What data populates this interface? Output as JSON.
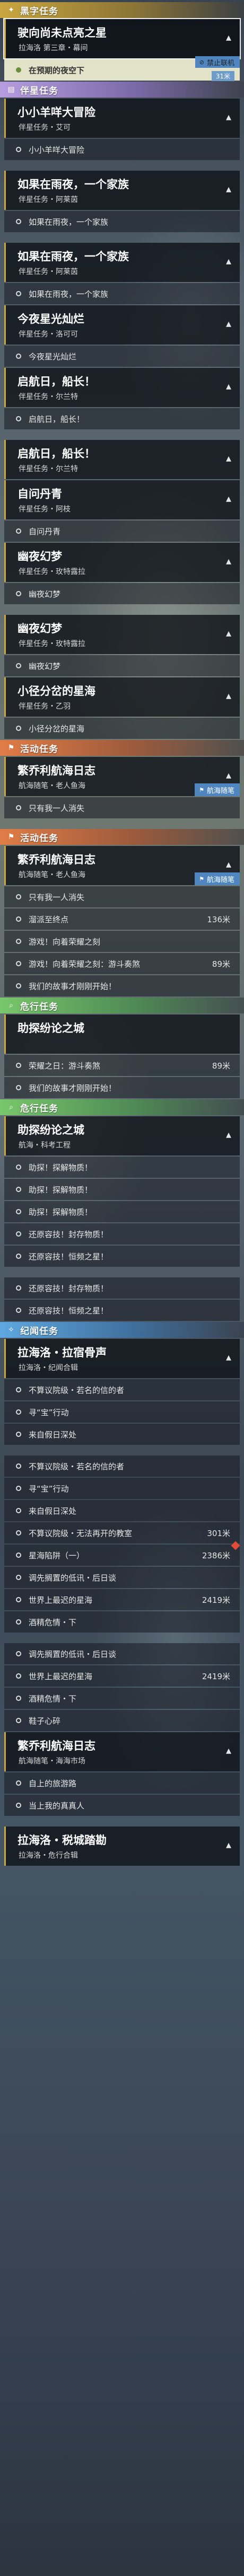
{
  "rows": [
    {
      "k": "header",
      "style": "gold",
      "icon": "star-icon",
      "title": "黑字任务"
    },
    {
      "k": "card",
      "title": "驶向尚未点亮之星",
      "sub": "拉海洛 第三章・幕间",
      "chev": "▴"
    },
    {
      "k": "obj",
      "text": "在预期的夜空下",
      "hl": true,
      "dist": "31米",
      "badge": "禁止联机"
    },
    {
      "k": "header",
      "style": "purple",
      "icon": "book-icon",
      "title": "伴星任务"
    },
    {
      "k": "card",
      "title": "小小羊咩大冒险",
      "sub": "伴星任务・艾可",
      "chev": "▴"
    },
    {
      "k": "obj",
      "text": "小小羊咩大冒险"
    },
    {
      "k": "gap"
    },
    {
      "k": "card",
      "title": "如果在雨夜，一个家族",
      "sub": "伴星任务・阿莱茵",
      "chev": "▴"
    },
    {
      "k": "obj",
      "text": "如果在雨夜，一个家族"
    },
    {
      "k": "gap"
    },
    {
      "k": "card",
      "title": "如果在雨夜，一个家族",
      "sub": "伴星任务・阿莱茵",
      "chev": "▴"
    },
    {
      "k": "obj",
      "text": "如果在雨夜，一个家族"
    },
    {
      "k": "card",
      "title": "今夜星光灿烂",
      "sub": "伴星任务・洛可可",
      "chev": "▴"
    },
    {
      "k": "obj",
      "text": "今夜星光灿烂"
    },
    {
      "k": "card",
      "title": "启航日，船长！",
      "sub": "伴星任务・尔兰特",
      "chev": "▴"
    },
    {
      "k": "obj",
      "text": "启航日，船长！"
    },
    {
      "k": "gap"
    },
    {
      "k": "card",
      "title": "启航日，船长！",
      "sub": "伴星任务・尔兰特",
      "chev": "▴"
    },
    {
      "k": "card",
      "title": "自问丹青",
      "sub": "伴星任务・阿枝",
      "chev": "▴"
    },
    {
      "k": "obj",
      "text": "自问丹青"
    },
    {
      "k": "card",
      "title": "幽夜幻梦",
      "sub": "伴星任务・玫特露拉",
      "chev": "▴"
    },
    {
      "k": "obj",
      "text": "幽夜幻梦"
    },
    {
      "k": "gap"
    },
    {
      "k": "card",
      "title": "幽夜幻梦",
      "sub": "伴星任务・玫特露拉",
      "chev": "▴"
    },
    {
      "k": "obj",
      "text": "幽夜幻梦"
    },
    {
      "k": "card",
      "title": "小径分岔的星海",
      "sub": "伴星任务・乙羽",
      "chev": "▴"
    },
    {
      "k": "obj",
      "text": "小径分岔的星海"
    },
    {
      "k": "header",
      "style": "orange",
      "icon": "flag-icon",
      "title": "活动任务"
    },
    {
      "k": "card",
      "title": "繁乔利航海日志",
      "sub": "航海随笔・老人鱼海",
      "chev": "▴",
      "badge": "航海随笔"
    },
    {
      "k": "obj",
      "text": "只有我一人消失"
    },
    {
      "k": "gap"
    },
    {
      "k": "header",
      "style": "orange",
      "icon": "flag-icon",
      "title": "活动任务"
    },
    {
      "k": "card",
      "title": "繁乔利航海日志",
      "sub": "航海随笔・老人鱼海",
      "chev": "▴",
      "badge": "航海随笔"
    },
    {
      "k": "obj",
      "text": "只有我一人消失"
    },
    {
      "k": "obj",
      "text": "溜派至终点",
      "dist": "136米"
    },
    {
      "k": "obj",
      "text": "游戏！向着荣耀之刻"
    },
    {
      "k": "obj",
      "text": "游戏！向着荣耀之刻：游斗奏煞",
      "dist": "89米"
    },
    {
      "k": "obj",
      "text": "我们的故事才刚刚开始！"
    },
    {
      "k": "header",
      "style": "green",
      "icon": "search-icon",
      "title": "危行任务"
    },
    {
      "k": "card",
      "title": "助探纷论之城",
      "sub": "",
      "chev": ""
    },
    {
      "k": "obj",
      "text": "荣耀之日：游斗奏煞",
      "dist": "89米"
    },
    {
      "k": "obj",
      "text": "我们的故事才刚刚开始！"
    },
    {
      "k": "header",
      "style": "green",
      "icon": "search-icon",
      "title": "危行任务"
    },
    {
      "k": "card",
      "title": "助探纷论之城",
      "sub": "航海・科考工程",
      "chev": "▴"
    },
    {
      "k": "obj",
      "text": "助探！探解物质！"
    },
    {
      "k": "obj",
      "text": "助探！探解物质！"
    },
    {
      "k": "obj",
      "text": "助探！探解物质！"
    },
    {
      "k": "obj",
      "text": "还原容技！封存物质！"
    },
    {
      "k": "obj",
      "text": "还原容技！恒频之星！"
    },
    {
      "k": "gap"
    },
    {
      "k": "obj",
      "text": "还原容技！封存物质！"
    },
    {
      "k": "obj",
      "text": "还原容技！恒频之星！"
    },
    {
      "k": "header",
      "style": "blue",
      "icon": "compass-icon",
      "title": "纪闻任务"
    },
    {
      "k": "card",
      "title": "拉海洛・拉宿骨声",
      "sub": "拉海洛・纪闻合辑",
      "chev": "▴"
    },
    {
      "k": "obj",
      "text": "不算议院级・若名的信的者"
    },
    {
      "k": "obj",
      "text": "寻“宝”行动"
    },
    {
      "k": "obj",
      "text": "来自假日深处"
    },
    {
      "k": "gap"
    },
    {
      "k": "obj",
      "text": "不算议院级・若名的信的者"
    },
    {
      "k": "obj",
      "text": "寻“宝”行动"
    },
    {
      "k": "obj",
      "text": "来自假日深处"
    },
    {
      "k": "obj",
      "text": "不算议院级・无法再开的教室",
      "dist": "301米"
    },
    {
      "k": "obj",
      "text": "星海陷阱（一）",
      "dist": "2386米",
      "diamond": true
    },
    {
      "k": "obj",
      "text": "调先搁置的低讯・后日谈"
    },
    {
      "k": "obj",
      "text": "世界上最迟的星海",
      "dist": "2419米"
    },
    {
      "k": "obj",
      "text": "酒精危情・下"
    },
    {
      "k": "gap"
    },
    {
      "k": "obj",
      "text": "调先搁置的低讯・后日谈"
    },
    {
      "k": "obj",
      "text": "世界上最迟的星海",
      "dist": "2419米"
    },
    {
      "k": "obj",
      "text": "酒精危情・下"
    },
    {
      "k": "obj",
      "text": "鞋子心碎"
    },
    {
      "k": "card",
      "title": "繁乔利航海日志",
      "sub": "航海随笔・海海市场",
      "chev": "▴"
    },
    {
      "k": "obj",
      "text": "自上的旅游路"
    },
    {
      "k": "obj",
      "text": "当上我的真真人"
    },
    {
      "k": "gap"
    },
    {
      "k": "card",
      "title": "拉海洛・税城踏勘",
      "sub": "拉海洛・危行合辑",
      "chev": "▴"
    }
  ]
}
